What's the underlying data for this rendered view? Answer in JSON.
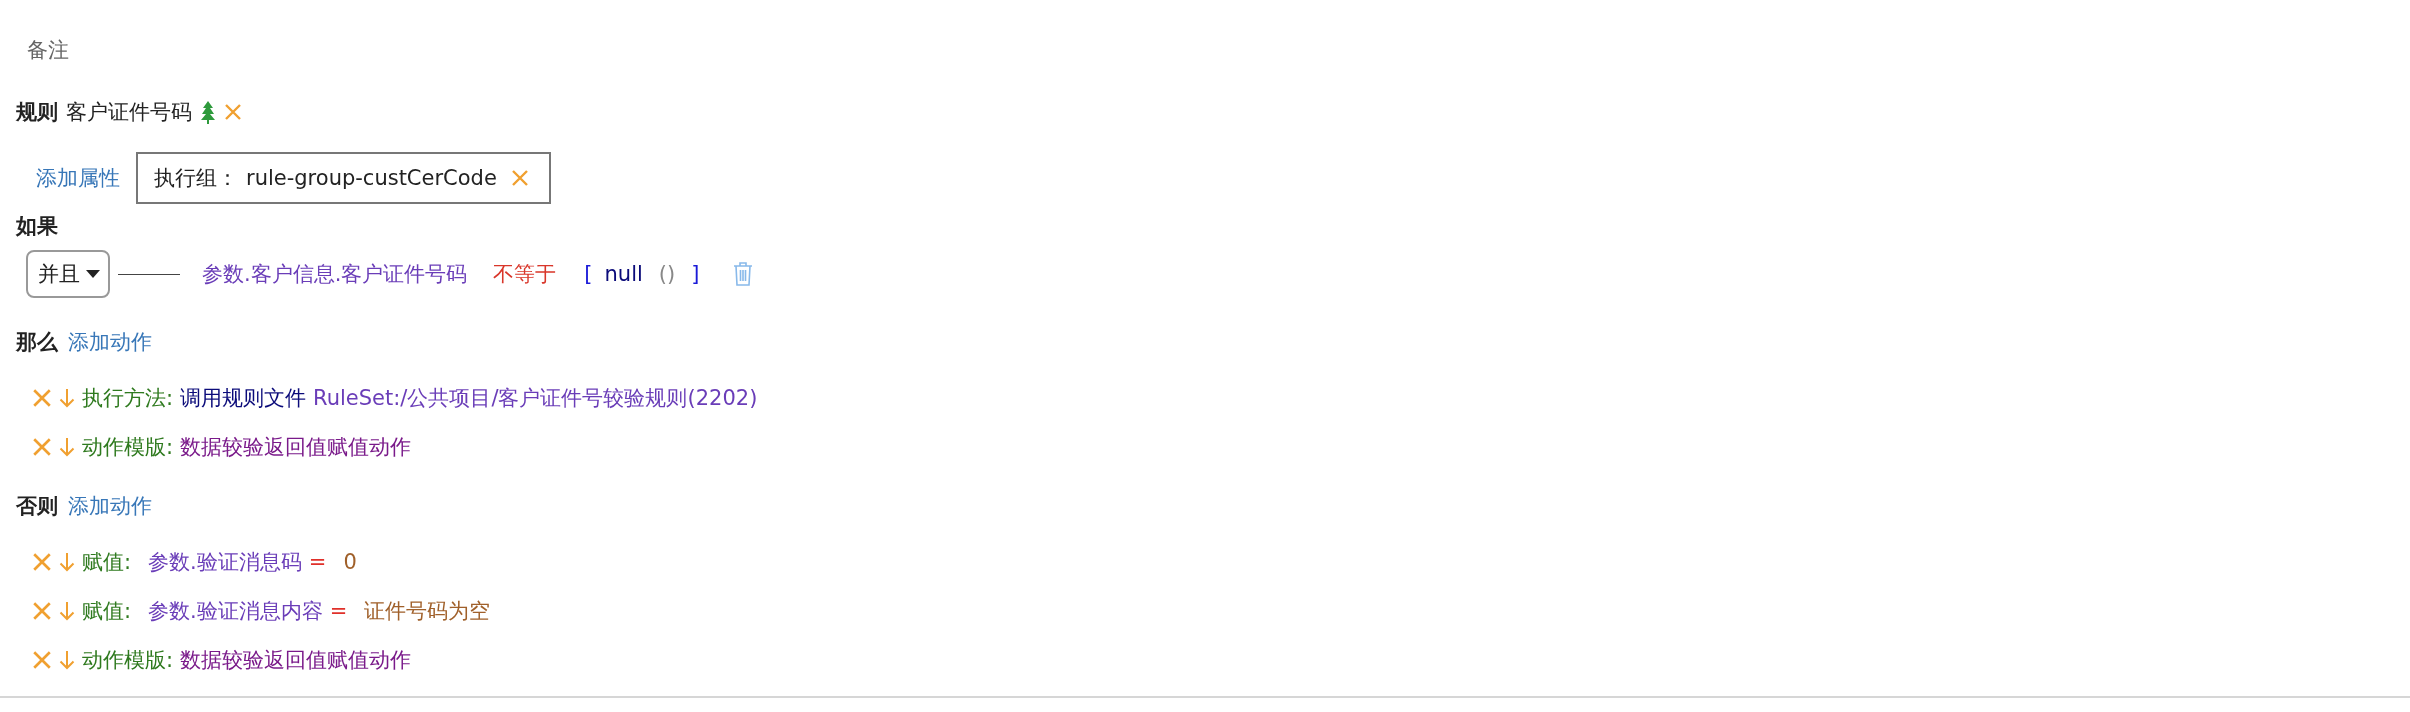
{
  "note": "备注",
  "rule": {
    "label": "规则",
    "name": "客户证件号码"
  },
  "attributes": {
    "add_label": "添加属性",
    "tags": [
      {
        "label": "执行组：",
        "value": "rule-group-custCerCode"
      }
    ]
  },
  "if": {
    "label": "如果",
    "operator": "并且",
    "conditions": [
      {
        "left": "参数.客户信息.客户证件号码",
        "op": "不等于",
        "open": "[",
        "value": "null",
        "parens": "()",
        "close": "]"
      }
    ]
  },
  "then": {
    "label": "那么",
    "add_label": "添加动作",
    "actions": [
      {
        "kind": "method",
        "label": "执行方法:",
        "method": "调用规则文件",
        "target": "RuleSet:/公共项目/客户证件号较验规则(2202)"
      },
      {
        "kind": "template",
        "label": "动作模版:",
        "target": "数据较验返回值赋值动作"
      }
    ]
  },
  "else": {
    "label": "否则",
    "add_label": "添加动作",
    "actions": [
      {
        "kind": "assign",
        "label": "赋值:",
        "target": "参数.验证消息码",
        "op": "=",
        "value": "0"
      },
      {
        "kind": "assign",
        "label": "赋值:",
        "target": "参数.验证消息内容",
        "op": "=",
        "value": "证件号码为空"
      },
      {
        "kind": "template",
        "label": "动作模版:",
        "target": "数据较验返回值赋值动作"
      }
    ]
  }
}
